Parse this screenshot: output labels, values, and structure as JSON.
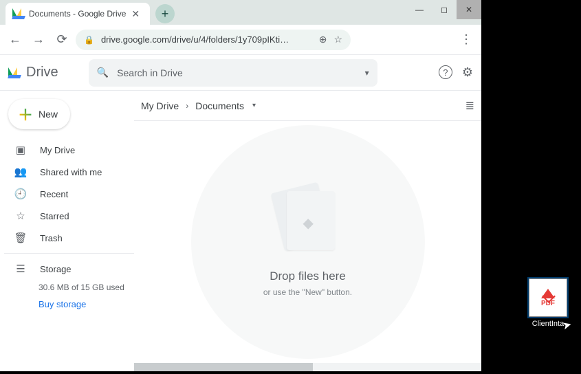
{
  "window": {
    "tab_title": "Documents - Google Drive",
    "minimize": "—",
    "maximize": "◻",
    "close": "✕",
    "newtab": "+"
  },
  "addr": {
    "url": "drive.google.com/drive/u/4/folders/1y709pIKti…",
    "back": "←",
    "forward": "→",
    "reload": "⟳",
    "lock": "🔒",
    "zoom": "⊕",
    "star": "☆",
    "menu": "⋮"
  },
  "header": {
    "product": "Drive",
    "search_placeholder": "Search in Drive",
    "help": "?",
    "settings": "⚙"
  },
  "sidebar": {
    "new_label": "New",
    "items": [
      {
        "icon": "▣",
        "label": "My Drive"
      },
      {
        "icon": "👥",
        "label": "Shared with me"
      },
      {
        "icon": "🕘",
        "label": "Recent"
      },
      {
        "icon": "☆",
        "label": "Starred"
      },
      {
        "icon": "🗑",
        "label": "Trash"
      }
    ],
    "storage_label": "Storage",
    "storage_icon": "☰",
    "storage_used": "30.6 MB of 15 GB used",
    "buy": "Buy storage"
  },
  "breadcrumb": {
    "root": "My Drive",
    "chev": "›",
    "current": "Documents",
    "drop": "▾",
    "view_icon": "≣"
  },
  "dropzone": {
    "title": "Drop files here",
    "subtitle": "or use the \"New\" button."
  },
  "desktop": {
    "file_label": "ClientInta",
    "pdf": "PDF"
  }
}
